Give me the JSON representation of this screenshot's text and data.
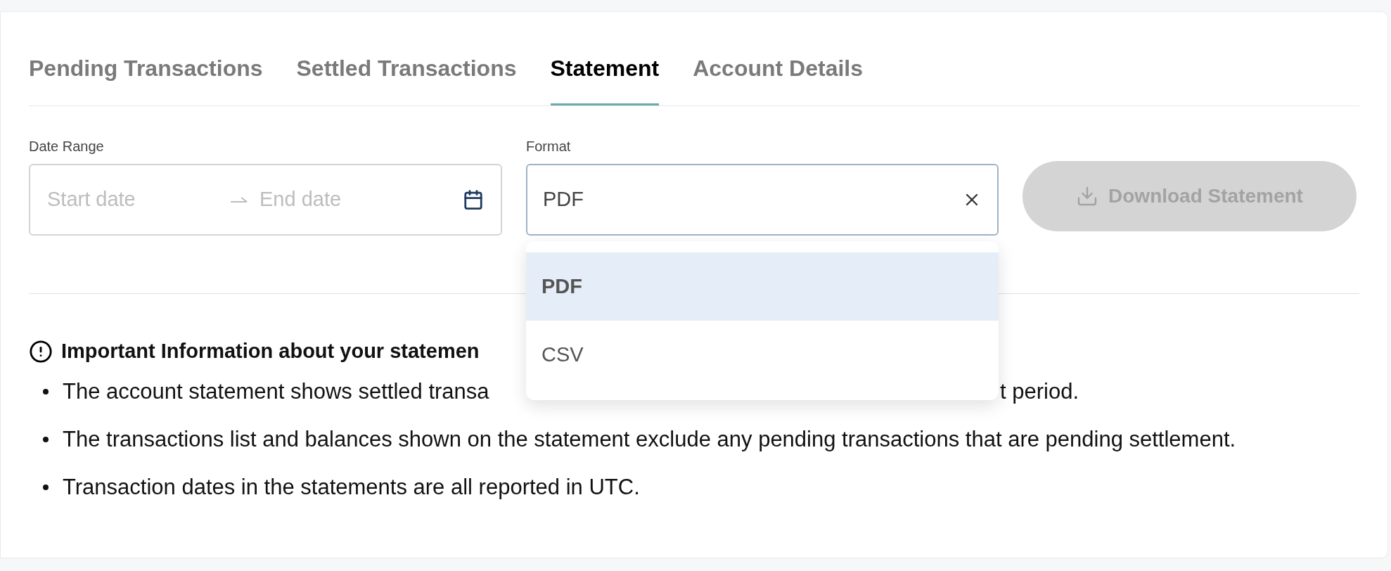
{
  "tabs": [
    {
      "label": "Pending Transactions",
      "selected": false
    },
    {
      "label": "Settled Transactions",
      "selected": false
    },
    {
      "label": "Statement",
      "selected": true
    },
    {
      "label": "Account Details",
      "selected": false
    }
  ],
  "date_range": {
    "label": "Date Range",
    "start_placeholder": "Start date",
    "end_placeholder": "End date"
  },
  "format": {
    "label": "Format",
    "value": "PDF",
    "expanded": true,
    "options": [
      {
        "label": "PDF",
        "selected": true
      },
      {
        "label": "CSV",
        "selected": false
      }
    ]
  },
  "download_button": {
    "label": "Download Statement",
    "disabled": true
  },
  "info": {
    "title": "Important Information about your statemen",
    "items": [
      [
        "The account statement shows settled transa",
        "t period."
      ],
      [
        "The transactions list and balances shown on the statement exclude any pending transactions that are pending settlement."
      ],
      [
        "Transaction dates in the statements are all reported in UTC."
      ]
    ]
  }
}
